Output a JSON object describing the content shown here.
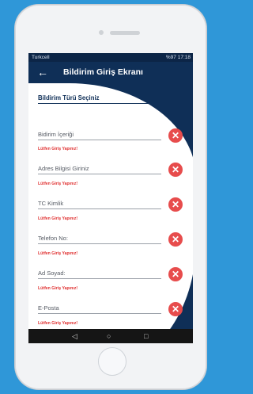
{
  "statusbar": {
    "carrier": "Turkcell",
    "time": "17:18",
    "battery": "%97"
  },
  "appbar": {
    "title": "Bildirim Giriş Ekranı"
  },
  "form": {
    "type_label": "Bildirim Türü Seçiniz",
    "fields": [
      {
        "label": "Bidirim İçeriği",
        "error": "Lütfen Giriş Yapınız!"
      },
      {
        "label": "Adres Bilgisi Giriniz",
        "error": "Lütfen Giriş Yapınız!"
      },
      {
        "label": "TC Kimlik",
        "error": "Lütfen Giriş Yapınız!"
      },
      {
        "label": "Telefon No:",
        "error": "Lütfen Giriş Yapınız!"
      },
      {
        "label": "Ad Soyad:",
        "error": "Lütfen Giriş Yapınız!"
      },
      {
        "label": "E-Posta",
        "error": "Lütfen Giriş Yapınız!"
      }
    ]
  },
  "icons": {
    "back": "arrow-left-icon",
    "clear": "close-icon"
  },
  "colors": {
    "appbar": "#0f2f57",
    "error": "#e03030",
    "clear_button": "#e74c4c",
    "background": "#2f97d8"
  }
}
